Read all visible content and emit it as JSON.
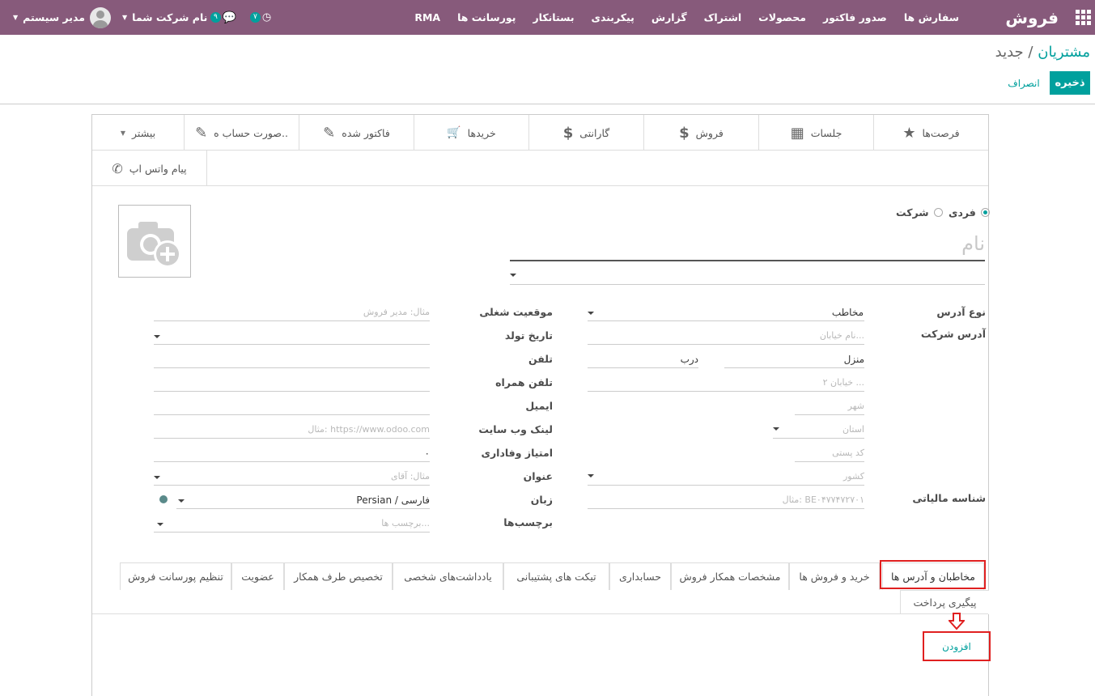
{
  "navbar": {
    "brand": "فروش",
    "menu": [
      "سفارش ها",
      "صدور فاکتور",
      "محصولات",
      "اشتراک",
      "گزارش",
      "پیکربندی",
      "بستانکار",
      "پورسانت ها",
      "RMA"
    ],
    "activity_count": "۷",
    "messages_count": "۹",
    "company": "نام شرکت شما",
    "user": "مدیر سیستم"
  },
  "breadcrumb": {
    "parent": "مشتریان",
    "separator": "/",
    "current": "جدید"
  },
  "actions": {
    "save": "ذخیره",
    "discard": "انصراف"
  },
  "smart_buttons": [
    {
      "label": "فرصت‌ها",
      "icon": "star-icon",
      "glyph": "★"
    },
    {
      "label": "جلسات",
      "icon": "calendar-icon",
      "glyph": "▦"
    },
    {
      "label": "فروش",
      "icon": "dollar-icon",
      "glyph": "$"
    },
    {
      "label": "گارانتی",
      "icon": "dollar-icon",
      "glyph": "$"
    },
    {
      "label": "خریدها",
      "icon": "cart-icon",
      "glyph": "🛒"
    },
    {
      "label": "فاکتور شده",
      "icon": "edit-icon",
      "glyph": "✎"
    },
    {
      "label": "صورت حساب ه..",
      "icon": "edit-icon",
      "glyph": "✎"
    },
    {
      "label": "بیشتر",
      "icon": "caret-down-icon",
      "glyph": "▼"
    }
  ],
  "whatsapp_button": "پیام واتس اپ",
  "company_type": {
    "individual": "فردی",
    "company": "شرکت"
  },
  "name_placeholder": "نام",
  "left_column": {
    "address_type_label": "نوع آدرس",
    "address_type_value": "مخاطب",
    "company_address_label": "آدرس شرکت",
    "street_placeholder": "نام خیابان...",
    "house_label": "منزل",
    "door_label": "درب",
    "street2_placeholder": "خیابان ۲ ...",
    "city_placeholder": "شهر",
    "state_placeholder": "استان",
    "zip_placeholder": "کد پستی",
    "country_placeholder": "کشور",
    "vat_label": "شناسه مالیاتی",
    "vat_placeholder": "مثال: BE۰۴۷۷۴۷۲۷۰۱"
  },
  "right_column": {
    "job_label": "موقعیت شغلی",
    "job_placeholder": "مثال: مدیر فروش",
    "birthday_label": "تاریخ تولد",
    "phone_label": "تلفن",
    "mobile_label": "تلفن همراه",
    "email_label": "ایمیل",
    "website_label": "لینک وب سایت",
    "website_placeholder": "مثال: https://www.odoo.com",
    "loyalty_label": "امتیاز وفاداری",
    "loyalty_value": "۰",
    "title_label": "عنوان",
    "title_placeholder": "مثال: آقای",
    "language_label": "زبان",
    "language_value": "Persian / فارسی",
    "tags_label": "برچسب‌ها",
    "tags_placeholder": "برچسب ها..."
  },
  "tabs": [
    "مخاطبان و آدرس ها",
    "خرید و فروش ها",
    "مشخصات همکار فروش",
    "حسابداری",
    "تیکت های پشتیبانی",
    "یادداشت‌های شخصی",
    "تخصیص طرف همکار",
    "عضویت",
    "تنظیم پورسانت فروش"
  ],
  "tab_second_row": "پیگیری پرداخت",
  "add_button": "افزودن",
  "colors": {
    "brand": "#875a7b",
    "primary": "#00a09d",
    "highlight": "#e02020"
  }
}
